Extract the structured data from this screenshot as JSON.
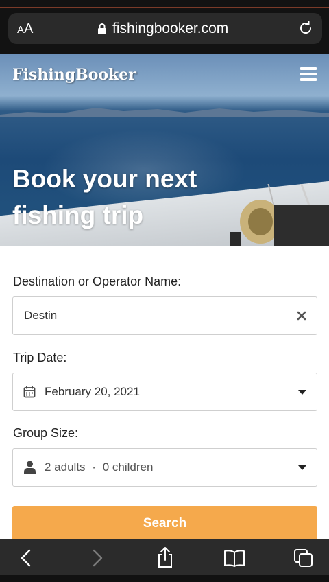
{
  "browser": {
    "text_size_label": "AA",
    "url": "fishingbooker.com"
  },
  "header": {
    "logo_text": "FishingBooker"
  },
  "hero": {
    "title_line1": "Book your next",
    "title_line2": "fishing trip"
  },
  "form": {
    "destination": {
      "label": "Destination or Operator Name:",
      "value": "Destin"
    },
    "trip_date": {
      "label": "Trip Date:",
      "value": "February 20, 2021"
    },
    "group_size": {
      "label": "Group Size:",
      "adults": "2 adults",
      "separator": "·",
      "children": "0 children"
    },
    "search_label": "Search"
  },
  "colors": {
    "search_button": "#f5a94c",
    "browser_chrome": "#2b2b2b"
  }
}
